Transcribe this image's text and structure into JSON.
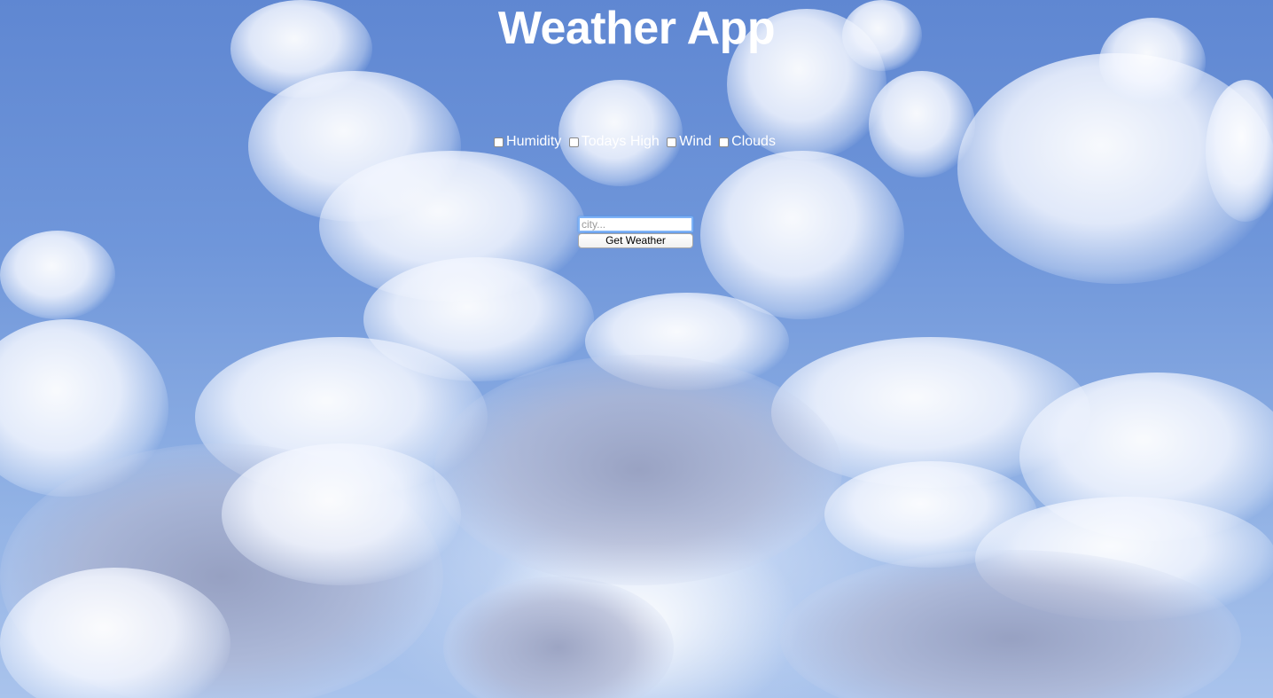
{
  "header": {
    "title": "Weather App"
  },
  "options": [
    {
      "label": "Humidity",
      "checked": false
    },
    {
      "label": "Todays High",
      "checked": false
    },
    {
      "label": "Wind",
      "checked": false
    },
    {
      "label": "Clouds",
      "checked": false
    }
  ],
  "form": {
    "city_placeholder": "city...",
    "city_value": "",
    "submit_label": "Get Weather"
  },
  "colors": {
    "sky": "#6f95d6",
    "text": "#ffffff",
    "input_focus": "#7fb3f7"
  }
}
